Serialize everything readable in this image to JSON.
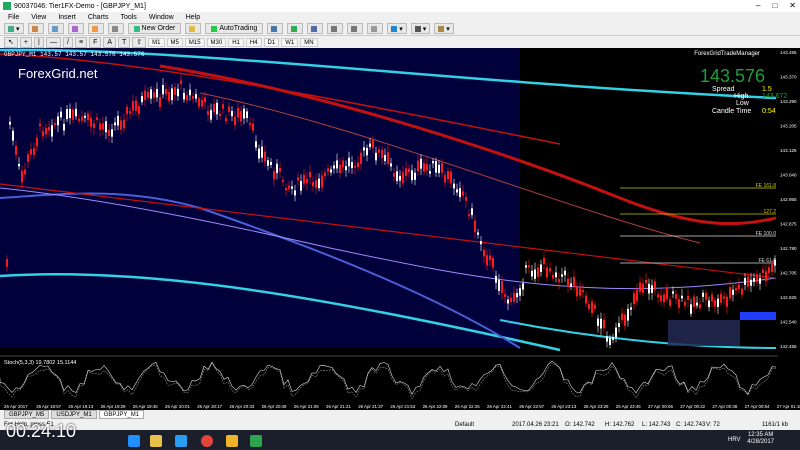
{
  "window": {
    "title": "90037046: Tier1FX-Demo - [GBPJPY_M1]"
  },
  "menu": [
    "File",
    "View",
    "Insert",
    "Charts",
    "Tools",
    "Window",
    "Help"
  ],
  "toolbar": {
    "new_order": "New Order",
    "autotrading": "AutoTrading"
  },
  "timeframes": [
    "M1",
    "M5",
    "M15",
    "M30",
    "H1",
    "H4",
    "D1",
    "W1",
    "MN"
  ],
  "chart": {
    "symbol_label": "GBPJPY_M1  143.57 143.57 143.576 143.576",
    "brand": "ForexGrid.net",
    "ea_name": "ForexGridTradeManager",
    "big_price": "143.576",
    "info": [
      {
        "label": "Spread",
        "value": "1.5"
      },
      {
        "label": "High",
        "value": "143.672"
      },
      {
        "label": "Low",
        "value": ""
      },
      {
        "label": "Candle Time",
        "value": "0:54"
      }
    ],
    "price_ticks": [
      "143.455",
      "143.370",
      "143.290",
      "143.205",
      "143.125",
      "143.040",
      "142.955",
      "142.875",
      "142.790",
      "142.705",
      "142.625",
      "142.540",
      "142.455"
    ],
    "fe_labels": [
      "FE 161.8",
      "127.2",
      "FE 100.0",
      "FE 61.8"
    ],
    "time_ticks": [
      "26 Apr 2017",
      "26 Apr 18:57",
      "26 Apr 19:13",
      "26 Apr 19:29",
      "26 Apr 19:45",
      "26 Apr 20:01",
      "26 Apr 20:17",
      "26 Apr 20:33",
      "26 Apr 20:49",
      "26 Apr 21:05",
      "26 Apr 21:21",
      "26 Apr 21:37",
      "26 Apr 21:53",
      "26 Apr 22:09",
      "26 Apr 22:25",
      "26 Apr 22:41",
      "26 Apr 22:57",
      "26 Apr 23:13",
      "26 Apr 23:29",
      "26 Apr 23:45",
      "27 Apr 00:06",
      "27 Apr 00:22",
      "27 Apr 00:38",
      "27 Apr 00:54",
      "27 Apr 01:10"
    ],
    "stoch_label": "Stoch(5,3,3) 19.7802 15.1144"
  },
  "tabs": [
    "GBPJPY_M5",
    "USDJPY_M1",
    "GBPJPY_M1"
  ],
  "status": {
    "help": "For Help, press F1",
    "profile": "Default",
    "datetime": "2017.04.26 23:21",
    "open": "O: 142.742",
    "high": "H: 142.762",
    "low": "L: 142.743",
    "close": "C: 142.743",
    "volume": "V: 72",
    "traffic": "1161/1 kb"
  },
  "overlay": {
    "timer": "00:24:10"
  },
  "tray": {
    "time": "12:35 AM",
    "date": "4/28/2017",
    "lang": "HRV"
  },
  "colors": {
    "chart_bg": "#00003a",
    "bull": "#ffffff",
    "bear": "#ff1a1a",
    "ma_cyan": "#34d0e6",
    "ma_blue": "#4a5fd6",
    "ma_red": "#c41010",
    "price_green": "#1f9e3a"
  }
}
